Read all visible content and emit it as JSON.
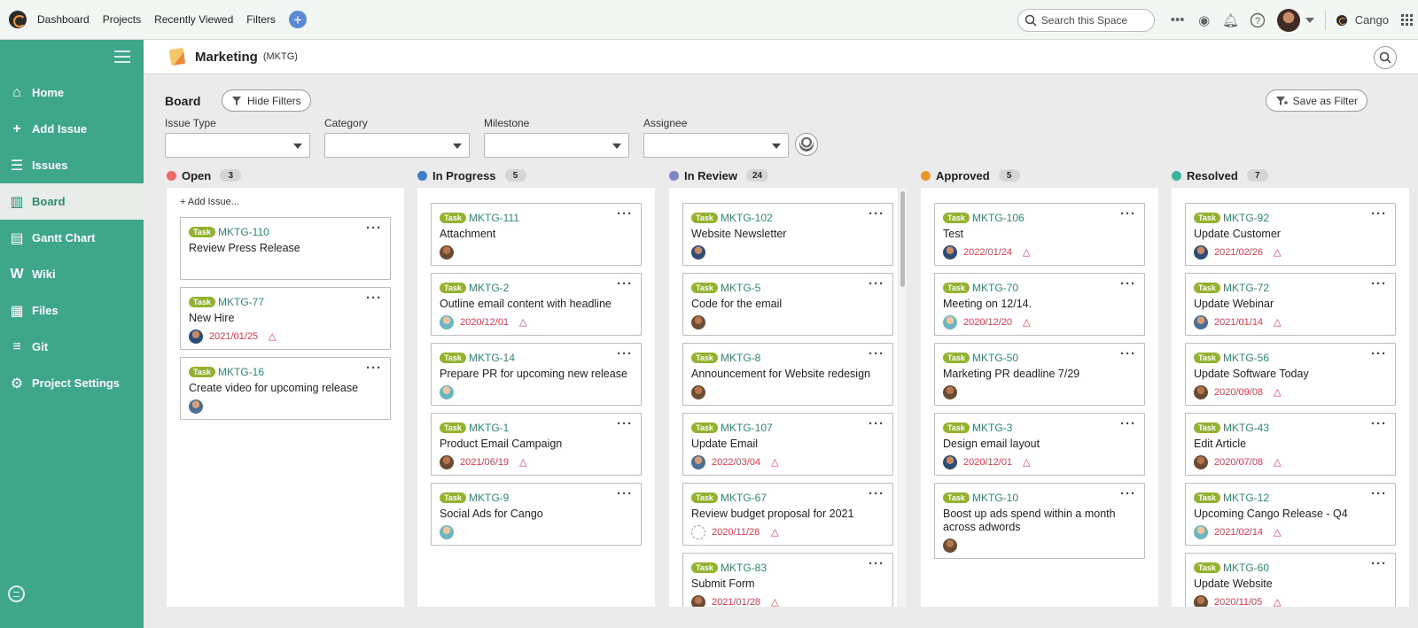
{
  "topnav": {
    "links": [
      "Dashboard",
      "Projects",
      "Recently Viewed",
      "Filters"
    ],
    "add_icon": "plus-circle-icon",
    "search_placeholder": "Search this Space",
    "org_name": "Cango"
  },
  "sidebar": {
    "items": [
      {
        "label": "Home",
        "icon": "home-icon",
        "glyph": "⌂"
      },
      {
        "label": "Add Issue",
        "icon": "plus-icon",
        "glyph": "+"
      },
      {
        "label": "Issues",
        "icon": "list-icon",
        "glyph": "☰"
      },
      {
        "label": "Board",
        "icon": "board-icon",
        "glyph": "▥"
      },
      {
        "label": "Gantt Chart",
        "icon": "gantt-icon",
        "glyph": "▤"
      },
      {
        "label": "Wiki",
        "icon": "wiki-icon",
        "glyph": "W"
      },
      {
        "label": "Files",
        "icon": "files-icon",
        "glyph": "▦"
      },
      {
        "label": "Git",
        "icon": "git-icon",
        "glyph": "≡"
      },
      {
        "label": "Project Settings",
        "icon": "gear-icon",
        "glyph": "⚙"
      }
    ],
    "active_index": 3
  },
  "project": {
    "name": "Marketing",
    "key": "(MKTG)"
  },
  "board": {
    "title": "Board",
    "hide_filters": "Hide Filters",
    "save_as_filter": "Save as Filter",
    "filters": [
      {
        "label": "Issue Type",
        "value": ""
      },
      {
        "label": "Category",
        "value": ""
      },
      {
        "label": "Milestone",
        "value": ""
      },
      {
        "label": "Assignee",
        "value": ""
      }
    ],
    "add_issue": "+ Add Issue..."
  },
  "colors": {
    "accent_green": "#3ea68b",
    "task_tag": "#93b22f",
    "due_red": "#e2354a"
  },
  "columns": [
    {
      "title": "Open",
      "count": "3",
      "dot": "#e86b6b",
      "cards": [
        {
          "tag": "Task",
          "key": "MKTG-110",
          "title": "Review Press Release",
          "due": "",
          "avatar": ""
        },
        {
          "tag": "Task",
          "key": "MKTG-77",
          "title": "New Hire",
          "due": "2021/01/25",
          "avatar": "alt1"
        },
        {
          "tag": "Task",
          "key": "MKTG-16",
          "title": "Create video for upcoming release",
          "due": "",
          "avatar": "std"
        }
      ]
    },
    {
      "title": "In Progress",
      "count": "5",
      "dot": "#3d7fc9",
      "cards": [
        {
          "tag": "Task",
          "key": "MKTG-111",
          "title": "Attachment",
          "due": "",
          "avatar": "alt3"
        },
        {
          "tag": "Task",
          "key": "MKTG-2",
          "title": "Outline email content with headline",
          "due": "2020/12/01",
          "avatar": "alt2"
        },
        {
          "tag": "Task",
          "key": "MKTG-14",
          "title": "Prepare PR for upcoming new release",
          "due": "",
          "avatar": "alt2"
        },
        {
          "tag": "Task",
          "key": "MKTG-1",
          "title": "Product Email Campaign",
          "due": "2021/06/19",
          "avatar": "alt3"
        },
        {
          "tag": "Task",
          "key": "MKTG-9",
          "title": "Social Ads for Cango",
          "due": "",
          "avatar": "alt2"
        }
      ]
    },
    {
      "title": "In Review",
      "count": "24",
      "dot": "#7e86c4",
      "cards": [
        {
          "tag": "Task",
          "key": "MKTG-102",
          "title": "Website Newsletter",
          "due": "",
          "avatar": "alt1"
        },
        {
          "tag": "Task",
          "key": "MKTG-5",
          "title": "Code for the email",
          "due": "",
          "avatar": "alt3"
        },
        {
          "tag": "Task",
          "key": "MKTG-8",
          "title": "Announcement for Website redesign",
          "due": "",
          "avatar": "alt3"
        },
        {
          "tag": "Task",
          "key": "MKTG-107",
          "title": "Update Email",
          "due": "2022/03/04",
          "avatar": "std"
        },
        {
          "tag": "Task",
          "key": "MKTG-67",
          "title": "Review budget proposal for 2021",
          "due": "2020/11/28",
          "avatar": "empty"
        },
        {
          "tag": "Task",
          "key": "MKTG-83",
          "title": "Submit Form",
          "due": "2021/01/28",
          "avatar": "alt3"
        }
      ]
    },
    {
      "title": "Approved",
      "count": "5",
      "dot": "#e8962e",
      "cards": [
        {
          "tag": "Task",
          "key": "MKTG-106",
          "title": "Test",
          "due": "2022/01/24",
          "avatar": "alt1"
        },
        {
          "tag": "Task",
          "key": "MKTG-70",
          "title": "Meeting on 12/14.",
          "due": "2020/12/20",
          "avatar": "alt2"
        },
        {
          "tag": "Task",
          "key": "MKTG-50",
          "title": "Marketing PR deadline 7/29",
          "due": "",
          "avatar": "alt3"
        },
        {
          "tag": "Task",
          "key": "MKTG-3",
          "title": "Design email layout",
          "due": "2020/12/01",
          "avatar": "alt1"
        },
        {
          "tag": "Task",
          "key": "MKTG-10",
          "title": "Boost up ads spend within a month across adwords",
          "due": "",
          "avatar": "alt3"
        }
      ]
    },
    {
      "title": "Resolved",
      "count": "7",
      "dot": "#3fb2a0",
      "cards": [
        {
          "tag": "Task",
          "key": "MKTG-92",
          "title": "Update Customer",
          "due": "2021/02/26",
          "avatar": "alt1"
        },
        {
          "tag": "Task",
          "key": "MKTG-72",
          "title": "Update Webinar",
          "due": "2021/01/14",
          "avatar": "std"
        },
        {
          "tag": "Task",
          "key": "MKTG-56",
          "title": "Update Software Today",
          "due": "2020/09/08",
          "avatar": "alt3"
        },
        {
          "tag": "Task",
          "key": "MKTG-43",
          "title": "Edit Article",
          "due": "2020/07/08",
          "avatar": "alt3"
        },
        {
          "tag": "Task",
          "key": "MKTG-12",
          "title": "Upcoming Cango Release - Q4",
          "due": "2021/02/14",
          "avatar": "alt2"
        },
        {
          "tag": "Task",
          "key": "MKTG-60",
          "title": "Update Website",
          "due": "2020/11/05",
          "avatar": "alt3"
        }
      ]
    }
  ]
}
